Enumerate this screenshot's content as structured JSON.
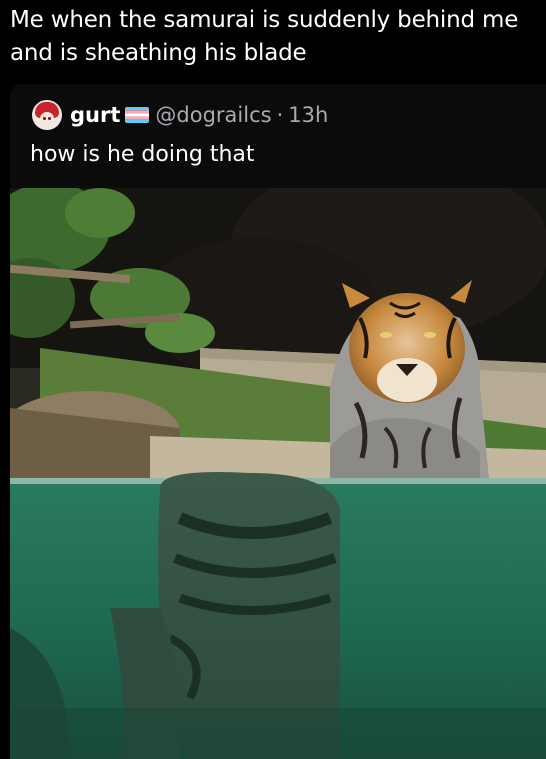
{
  "caption": "Me when the samurai is suddenly behind me and is sheathing his blade",
  "tweet": {
    "name": "gurt",
    "handle": "@dograilcs",
    "separator": "·",
    "time": "13h",
    "text": "how is he doing that"
  },
  "flag_colors": [
    "#5bcefa",
    "#f5a9b8",
    "#ffffff",
    "#f5a9b8",
    "#5bcefa"
  ],
  "icons": {
    "avatar": "anime-character-avatar",
    "flag": "transgender-flag-icon"
  },
  "photo": {
    "subject": "tiger-in-water",
    "colors": {
      "background_rock": "#161411",
      "water": "#1f6a52",
      "ledge": "#b7ab94",
      "fur_orange": "#c98a3e"
    }
  }
}
